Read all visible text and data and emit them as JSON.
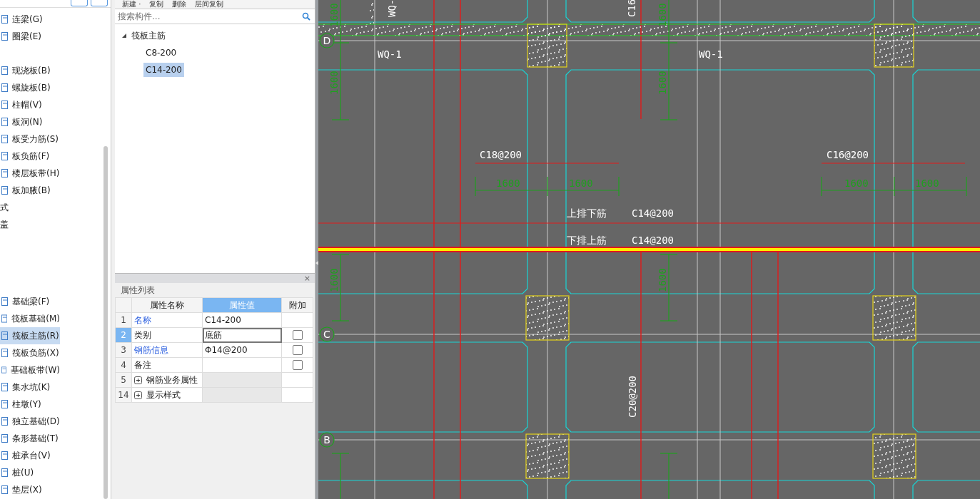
{
  "sidebar": {
    "groups": [
      {
        "items": [
          {
            "label": "连梁(G)",
            "kind": "component",
            "selected": false
          },
          {
            "label": "圈梁(E)",
            "kind": "component",
            "selected": false
          }
        ]
      },
      {
        "items": [
          {
            "label": "现浇板(B)",
            "kind": "component",
            "selected": false
          },
          {
            "label": "螺旋板(B)",
            "kind": "component",
            "selected": false
          },
          {
            "label": "柱帽(V)",
            "kind": "component",
            "selected": false
          },
          {
            "label": "板洞(N)",
            "kind": "component",
            "selected": false
          },
          {
            "label": "板受力筋(S)",
            "kind": "component",
            "selected": false
          },
          {
            "label": "板负筋(F)",
            "kind": "component",
            "selected": false
          },
          {
            "label": "楼层板带(H)",
            "kind": "component",
            "selected": false
          },
          {
            "label": "板加腋(B)",
            "kind": "component",
            "selected": false
          },
          {
            "label": "式",
            "kind": "category",
            "selected": false
          },
          {
            "label": "盖",
            "kind": "category",
            "selected": false
          }
        ]
      },
      {
        "items": [
          {
            "label": "基础梁(F)",
            "kind": "component",
            "selected": false
          },
          {
            "label": "筏板基础(M)",
            "kind": "component",
            "selected": false
          },
          {
            "label": "筏板主筋(R)",
            "kind": "component",
            "selected": true
          },
          {
            "label": "筏板负筋(X)",
            "kind": "component",
            "selected": false
          },
          {
            "label": "基础板带(W)",
            "kind": "component",
            "selected": false
          },
          {
            "label": "集水坑(K)",
            "kind": "component",
            "selected": false
          },
          {
            "label": "柱墩(Y)",
            "kind": "component",
            "selected": false
          },
          {
            "label": "独立基础(D)",
            "kind": "component",
            "selected": false
          },
          {
            "label": "条形基础(T)",
            "kind": "component",
            "selected": false
          },
          {
            "label": "桩承台(V)",
            "kind": "component",
            "selected": false
          },
          {
            "label": "桩(U)",
            "kind": "component",
            "selected": false
          },
          {
            "label": "垫层(X)",
            "kind": "component",
            "selected": false
          }
        ]
      }
    ]
  },
  "toolbar": [
    {
      "label": "新建 ·"
    },
    {
      "label": "复制"
    },
    {
      "label": "删除"
    },
    {
      "label": "层间复制"
    }
  ],
  "search": {
    "placeholder": "搜索构件..."
  },
  "tree": {
    "label": "筏板主筋",
    "expanded": true,
    "children": [
      {
        "label": "C8-200",
        "selected": false
      },
      {
        "label": "C14-200",
        "selected": true
      }
    ]
  },
  "properties": {
    "title": "属性列表",
    "close": "×",
    "columns": [
      "属性名称",
      "属性值",
      "附加"
    ],
    "rows": [
      {
        "num": "1",
        "name": "名称",
        "link": true,
        "value": "C14-200",
        "selected": false,
        "kind": "field"
      },
      {
        "num": "2",
        "name": "类别",
        "link": false,
        "value": "底筋",
        "selected": true,
        "checked": false,
        "kind": "field"
      },
      {
        "num": "3",
        "name": "钢筋信息",
        "link": true,
        "value": "Φ14@200",
        "selected": false,
        "checked": false,
        "kind": "field"
      },
      {
        "num": "4",
        "name": "备注",
        "link": false,
        "selected": false,
        "checked": false,
        "kind": "field"
      },
      {
        "num": "5",
        "name": "钢筋业务属性",
        "link": false,
        "selected": false,
        "expanded": false,
        "kind": "group"
      },
      {
        "num": "14",
        "name": "显示样式",
        "link": false,
        "selected": false,
        "expanded": false,
        "kind": "group"
      }
    ]
  },
  "canvas": {
    "axes": [
      "D",
      "C",
      "B"
    ],
    "labels": [
      {
        "text": "WQ-",
        "kind": "label"
      },
      {
        "text": "C16",
        "kind": "label"
      },
      {
        "text": "1600",
        "kind": "dim"
      },
      {
        "text": "1600",
        "kind": "dim"
      },
      {
        "text": "WQ-1",
        "kind": "label"
      },
      {
        "text": "WQ-1",
        "kind": "label"
      },
      {
        "text": "1600",
        "kind": "dim"
      },
      {
        "text": "1600",
        "kind": "dim"
      },
      {
        "text": "C18@200",
        "kind": "label"
      },
      {
        "text": "C16@200",
        "kind": "label"
      },
      {
        "text": "1600",
        "kind": "dim"
      },
      {
        "text": "1600",
        "kind": "dim"
      },
      {
        "text": "1600",
        "kind": "dim"
      },
      {
        "text": "1600",
        "kind": "dim"
      },
      {
        "text": "上排下筋",
        "kind": "label"
      },
      {
        "text": "C14@200",
        "kind": "label"
      },
      {
        "text": "下排上筋",
        "kind": "label"
      },
      {
        "text": "C14@200",
        "kind": "label"
      },
      {
        "text": "1600",
        "kind": "dim"
      },
      {
        "text": "1600",
        "kind": "dim"
      },
      {
        "text": "C20@200",
        "kind": "label"
      }
    ]
  }
}
